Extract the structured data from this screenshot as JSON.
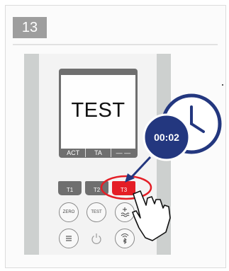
{
  "step": {
    "number": "13"
  },
  "device": {
    "screen_text": "TEST",
    "softkeys": [
      "ACT",
      "TA",
      "— —"
    ],
    "function_keys": [
      {
        "label": "T1",
        "active": false
      },
      {
        "label": "T2",
        "active": false
      },
      {
        "label": "T3",
        "active": true
      }
    ],
    "buttons": [
      {
        "label": "ZERO",
        "icon": ""
      },
      {
        "label": "TEST",
        "icon": ""
      },
      {
        "label": "",
        "icon": "plus-minus-wave-icon"
      },
      {
        "label": "",
        "icon": "menu-lines-icon"
      },
      {
        "label": "",
        "icon": "power-icon"
      },
      {
        "label": "",
        "icon": "wireless-bluetooth-icon"
      }
    ]
  },
  "timer": {
    "text": "00:02"
  },
  "colors": {
    "accent_red": "#e41e26",
    "timer_blue": "#23377f",
    "key_gray": "#6f6f6f",
    "strip_gray": "#cdd0cf"
  }
}
